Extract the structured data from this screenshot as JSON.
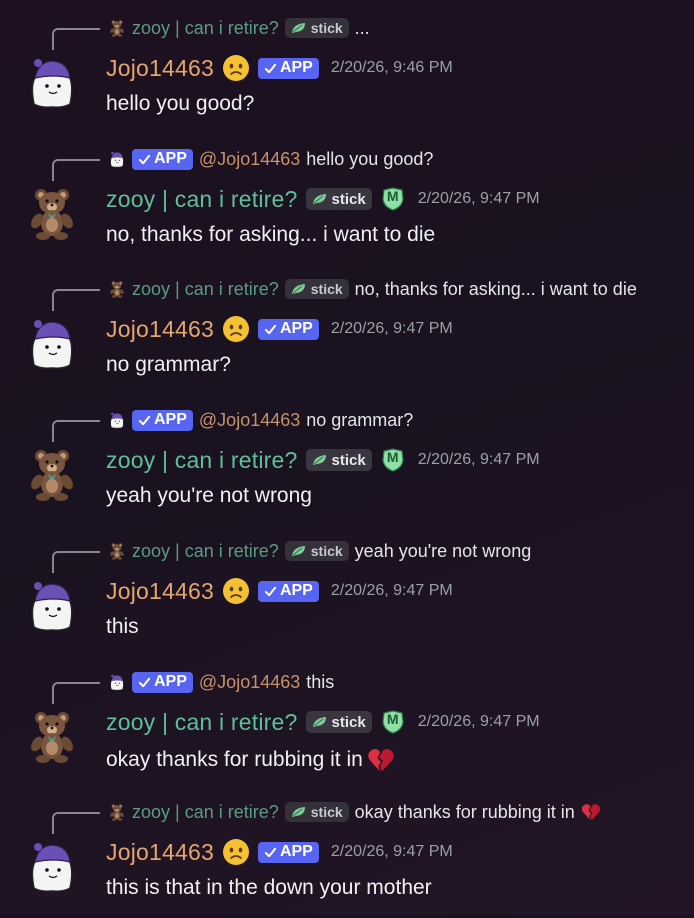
{
  "users": {
    "jojo": {
      "name": "Jojo14463",
      "mention": "@Jojo14463"
    },
    "zooy": {
      "name": "zooy | can i retire?"
    }
  },
  "badges": {
    "app": "APP",
    "guild_tag": "stick",
    "tag_letter": "M"
  },
  "colors": {
    "accent": "#5865f2",
    "jojo_name": "#e5a66e",
    "zooy_name": "#5fbf98"
  },
  "icons": {
    "jojo_avatar": "ghost-beanie-icon",
    "zooy_avatar": "teddy-bear-icon",
    "sad": "sad-face-emoji",
    "broken": "broken-heart-emoji"
  },
  "messages": [
    {
      "author": "Jojo14463",
      "reply_author": "zooy | can i retire?",
      "reply_text": "...",
      "timestamp": "2/20/26, 9:46 PM",
      "text": "hello you good?"
    },
    {
      "author": "zooy | can i retire?",
      "reply_author": "@Jojo14463",
      "reply_text": "hello you good?",
      "timestamp": "2/20/26, 9:47 PM",
      "text": "no, thanks for asking... i want to die"
    },
    {
      "author": "Jojo14463",
      "reply_author": "zooy | can i retire?",
      "reply_text": "no, thanks for asking... i want to die",
      "timestamp": "2/20/26, 9:47 PM",
      "text": "no grammar?"
    },
    {
      "author": "zooy | can i retire?",
      "reply_author": "@Jojo14463",
      "reply_text": "no grammar?",
      "timestamp": "2/20/26, 9:47 PM",
      "text": "yeah you're not wrong"
    },
    {
      "author": "Jojo14463",
      "reply_author": "zooy | can i retire?",
      "reply_text": "yeah you're not wrong",
      "timestamp": "2/20/26, 9:47 PM",
      "text": "this"
    },
    {
      "author": "zooy | can i retire?",
      "reply_author": "@Jojo14463",
      "reply_text": "this",
      "timestamp": "2/20/26, 9:47 PM",
      "text": "okay thanks for rubbing it in"
    },
    {
      "author": "Jojo14463",
      "reply_author": "zooy | can i retire?",
      "reply_text": "okay thanks for rubbing it in",
      "timestamp": "2/20/26, 9:47 PM",
      "text": "this is that in the down your mother"
    }
  ]
}
